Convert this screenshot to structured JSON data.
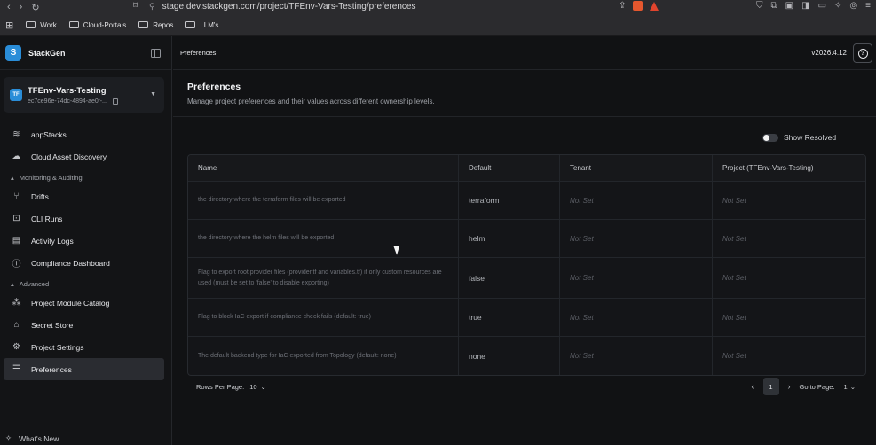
{
  "browser": {
    "url": "stage.dev.stackgen.com/project/TFEnv-Vars-Testing/preferences",
    "bookmarks": [
      "Work",
      "Cloud-Portals",
      "Repos",
      "LLM's"
    ]
  },
  "sidebar": {
    "brand": "StackGen",
    "project": {
      "avatar": "TF",
      "name": "TFEnv-Vars-Testing",
      "id": "ec7ce96e-74dc-4894-ae0f-..."
    },
    "items_top": [
      {
        "label": "appStacks",
        "icon": "layers-icon"
      },
      {
        "label": "Cloud Asset Discovery",
        "icon": "cloud-search-icon"
      }
    ],
    "section_monitoring": "Monitoring & Auditing",
    "items_monitoring": [
      {
        "label": "Drifts",
        "icon": "branch-icon"
      },
      {
        "label": "CLI Runs",
        "icon": "terminal-icon"
      },
      {
        "label": "Activity Logs",
        "icon": "log-icon"
      },
      {
        "label": "Compliance Dashboard",
        "icon": "alert-circle-icon"
      }
    ],
    "section_advanced": "Advanced",
    "items_advanced": [
      {
        "label": "Project Module Catalog",
        "icon": "modules-icon"
      },
      {
        "label": "Secret Store",
        "icon": "secret-icon"
      },
      {
        "label": "Project Settings",
        "icon": "gear-icon"
      },
      {
        "label": "Preferences",
        "icon": "sliders-icon"
      }
    ],
    "whats_new": "What's New"
  },
  "topbar": {
    "breadcrumb": "Preferences",
    "version": "v2026.4.12"
  },
  "page": {
    "title": "Preferences",
    "subtitle": "Manage project preferences and their values across different ownership levels.",
    "toggle_label": "Show Resolved"
  },
  "table": {
    "headers": [
      "Name",
      "Default",
      "Tenant",
      "Project (TFEnv-Vars-Testing)"
    ],
    "rows": [
      {
        "name": "the directory where the terraform files will be exported",
        "default": "terraform",
        "tenant": "Not Set",
        "project": "Not Set"
      },
      {
        "name": "the directory where the helm files will be exported",
        "default": "helm",
        "tenant": "Not Set",
        "project": "Not Set"
      },
      {
        "name": "Flag to export root provider files (provider.tf and variables.tf) if only custom resources are used (must be set to 'false' to disable exporting)",
        "default": "false",
        "tenant": "Not Set",
        "project": "Not Set"
      },
      {
        "name": "Flag to block IaC export if compliance check fails (default: true)",
        "default": "true",
        "tenant": "Not Set",
        "project": "Not Set"
      },
      {
        "name": "The default backend type for IaC exported from Topology (default: none)",
        "default": "none",
        "tenant": "Not Set",
        "project": "Not Set"
      }
    ]
  },
  "pagination": {
    "rows_per_page_label": "Rows Per Page:",
    "rows_per_page": "10",
    "current_page": "1",
    "go_to_label": "Go to Page:",
    "go_to_value": "1"
  }
}
